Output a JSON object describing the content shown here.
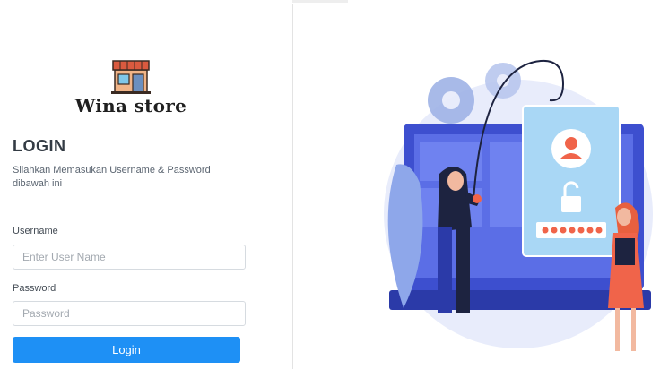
{
  "brand": {
    "name": "Wina store",
    "logo_icon": "store-icon"
  },
  "login": {
    "title": "LOGIN",
    "subtitle": "Silahkan Memasukan Username & Password dibawah ini",
    "username_label": "Username",
    "username_placeholder": "Enter User Name",
    "password_label": "Password",
    "password_placeholder": "Password",
    "submit_label": "Login"
  },
  "colors": {
    "primary_button": "#1e90f5",
    "illustration_blue": "#4a5fe0",
    "illustration_orange": "#f0644a"
  },
  "illustration": {
    "icon": "phishing-hacker-illustration"
  }
}
